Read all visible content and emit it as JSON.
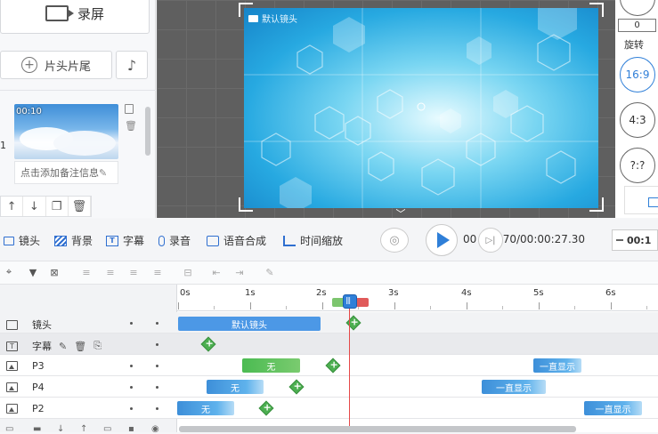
{
  "left_panel": {
    "record_label": "录屏",
    "head_tail_label": "片头片尾",
    "clip_index": "1",
    "clip_time": "00:10",
    "clip_note": "点击添加备注信息"
  },
  "preview": {
    "canvas_label": "默认镜头"
  },
  "right_panel": {
    "zero_value": "0",
    "rotate_label": "旋转",
    "ratio_169": "16:9",
    "ratio_43": "4:3",
    "ratio_custom": "?:?"
  },
  "toolbar": {
    "lens": "镜头",
    "background": "背景",
    "subtitle": "字幕",
    "record_audio": "录音",
    "tts": "语音合成",
    "time_zoom": "时间缩放",
    "time_current_prefix": "00",
    "time_rest": "2.70/00:00:27.30",
    "time_input": "00:1"
  },
  "timeline": {
    "ruler": [
      "0s",
      "1s",
      "2s",
      "3s",
      "4s",
      "5s",
      "6s"
    ],
    "rows": [
      {
        "name": "镜头",
        "clip": "默认镜头"
      },
      {
        "name": "字幕"
      },
      {
        "name": "P3",
        "clip": "无",
        "badge": "一直显示"
      },
      {
        "name": "P4",
        "clip": "无",
        "badge": "一直显示"
      },
      {
        "name": "P2",
        "clip": "无",
        "badge": "一直显示"
      }
    ]
  },
  "colors": {
    "accent": "#2f7fd8",
    "clip_blue": "#4c98e6",
    "keyframe_green": "#4caf50",
    "playhead_red": "#e54848"
  }
}
